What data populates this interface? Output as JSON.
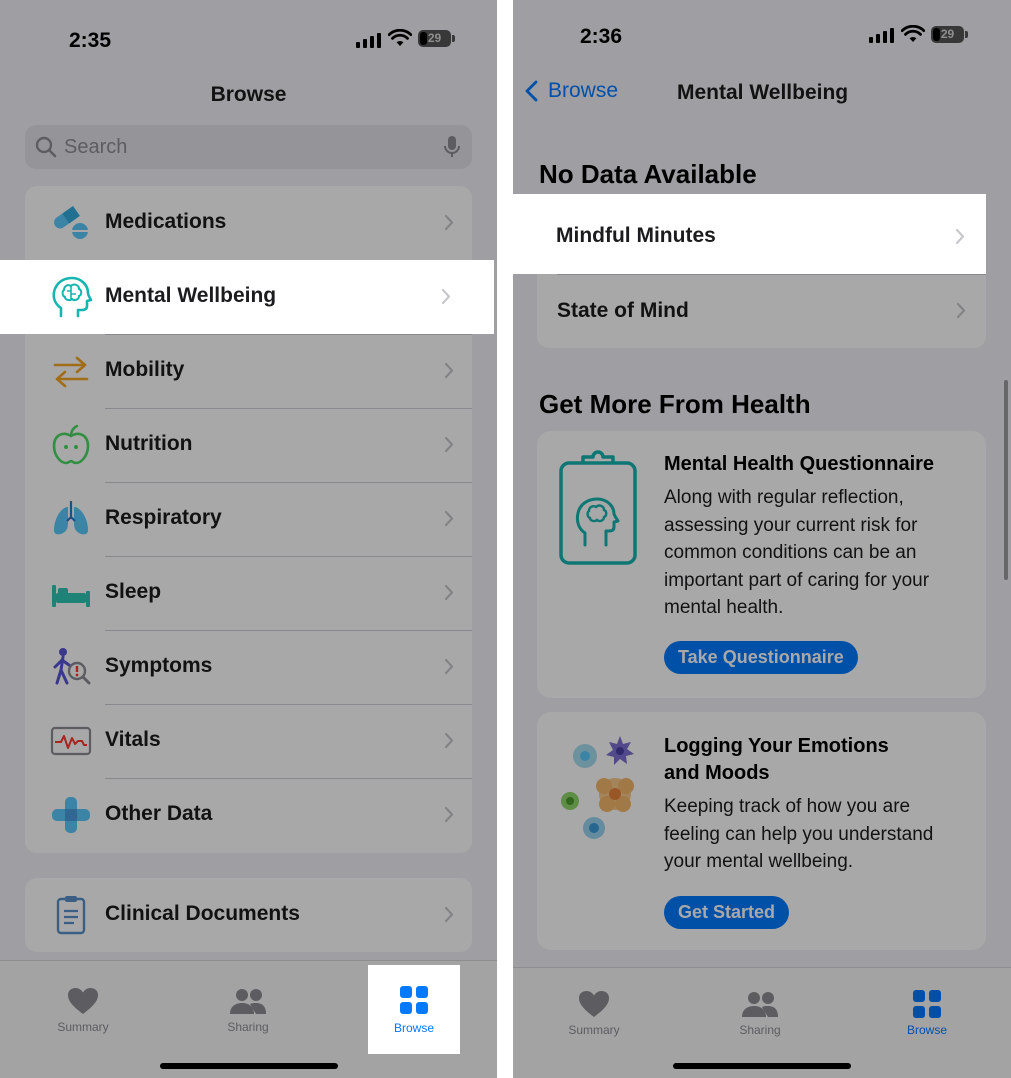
{
  "left": {
    "status": {
      "time": "2:35",
      "battery": "29"
    },
    "nav_title": "Browse",
    "search": {
      "placeholder": "Search"
    },
    "categories": [
      {
        "label": "Medications",
        "icon": "medications-icon"
      },
      {
        "label": "Mental Wellbeing",
        "icon": "mental-wellbeing-icon"
      },
      {
        "label": "Mobility",
        "icon": "mobility-icon"
      },
      {
        "label": "Nutrition",
        "icon": "nutrition-icon"
      },
      {
        "label": "Respiratory",
        "icon": "respiratory-icon"
      },
      {
        "label": "Sleep",
        "icon": "sleep-icon"
      },
      {
        "label": "Symptoms",
        "icon": "symptoms-icon"
      },
      {
        "label": "Vitals",
        "icon": "vitals-icon"
      },
      {
        "label": "Other Data",
        "icon": "other-data-icon"
      }
    ],
    "clinical": {
      "label": "Clinical Documents",
      "icon": "clinical-documents-icon"
    },
    "tabs": [
      {
        "label": "Summary",
        "icon": "heart-icon"
      },
      {
        "label": "Sharing",
        "icon": "people-icon"
      },
      {
        "label": "Browse",
        "icon": "grid-icon",
        "selected": true
      }
    ]
  },
  "right": {
    "status": {
      "time": "2:36",
      "battery": "29"
    },
    "back_label": "Browse",
    "nav_title": "Mental Wellbeing",
    "no_data_title": "No Data Available",
    "items": [
      {
        "label": "Mindful Minutes"
      },
      {
        "label": "State of Mind"
      }
    ],
    "more_title": "Get More From Health",
    "promos": [
      {
        "title": "Mental Health Questionnaire",
        "body_lines": [
          "Along with regular reflection,",
          "assessing your current risk for",
          "common conditions can be an",
          "important part of caring for your",
          "mental health."
        ],
        "button": "Take Questionnaire",
        "icon": "questionnaire-clipboard-icon"
      },
      {
        "title_lines": [
          "Logging Your Emotions",
          "and Moods"
        ],
        "body_lines": [
          "Keeping track of how you are",
          "feeling can help you understand",
          "your mental wellbeing."
        ],
        "button": "Get Started",
        "icon": "emotion-flowers-icon"
      }
    ],
    "tabs": [
      {
        "label": "Summary",
        "icon": "heart-icon"
      },
      {
        "label": "Sharing",
        "icon": "people-icon"
      },
      {
        "label": "Browse",
        "icon": "grid-icon",
        "selected": true
      }
    ]
  },
  "colors": {
    "accent": "#007aff",
    "teal": "#16b5b0",
    "tab_inactive": "#8e8e93",
    "background": "#f2f2f7"
  }
}
